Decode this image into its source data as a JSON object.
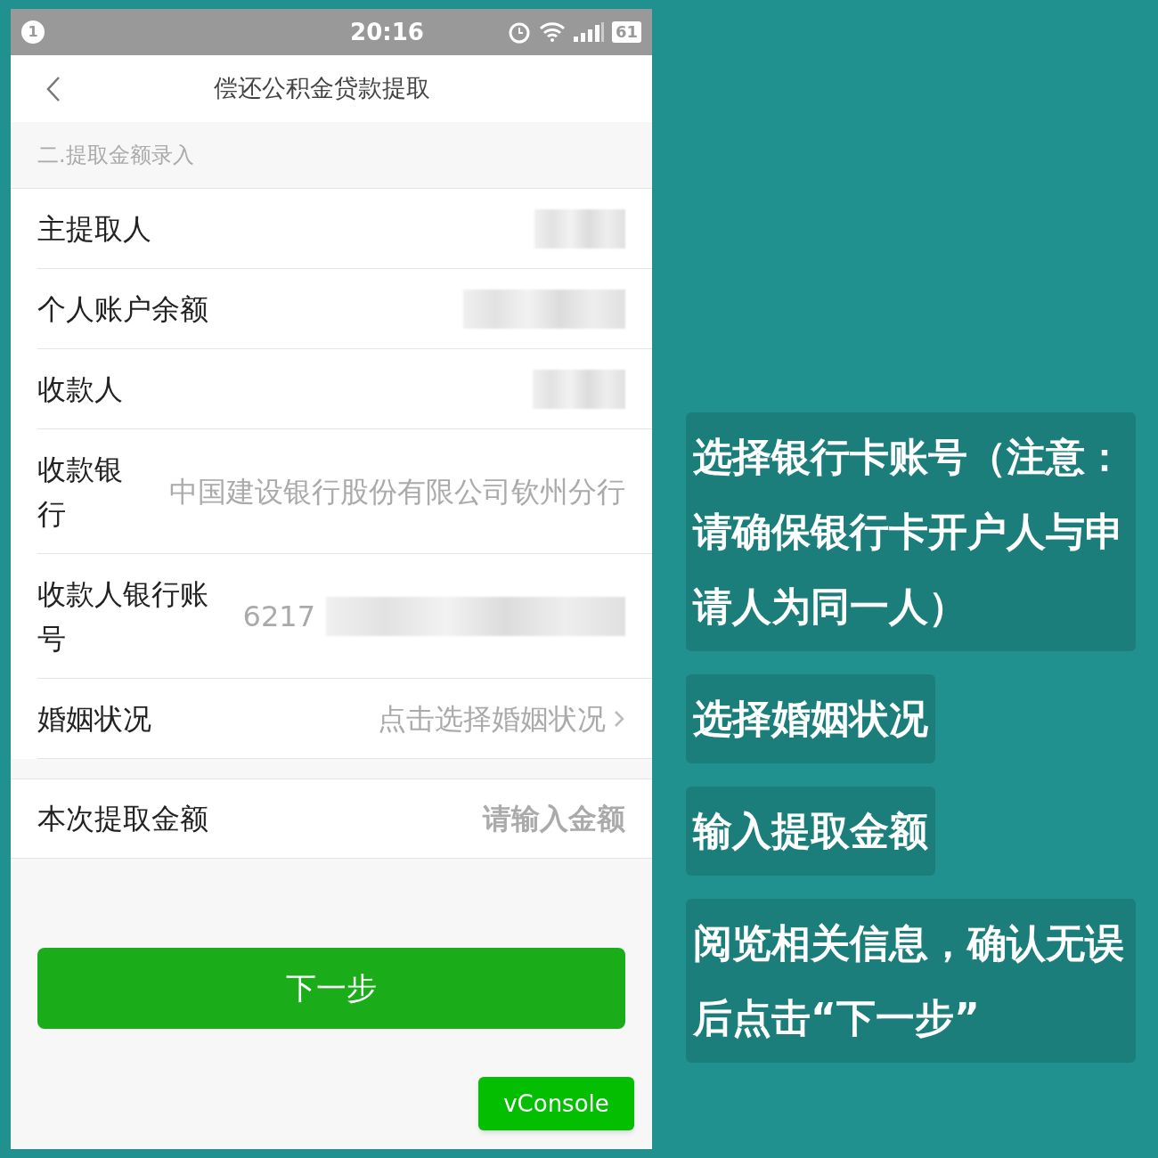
{
  "status_bar": {
    "notification_count": "1",
    "time": "20:16",
    "battery": "61"
  },
  "nav": {
    "title": "偿还公积金贷款提取"
  },
  "section_header": "二.提取金额录入",
  "rows": [
    {
      "kind": "redacted",
      "label": "主提取人"
    },
    {
      "kind": "redacted",
      "label": "个人账户余额"
    },
    {
      "kind": "redacted",
      "label": "收款人"
    },
    {
      "kind": "text",
      "label": "收款银行",
      "value": "中国建设银行股份有限公司钦州分行"
    },
    {
      "kind": "partial",
      "label": "收款人银行账号",
      "value": "6217"
    },
    {
      "kind": "select",
      "label": "婚姻状况",
      "placeholder": "点击选择婚姻状况"
    }
  ],
  "amount_row": {
    "label": "本次提取金额",
    "placeholder": "请输入金额"
  },
  "next_button": "下一步",
  "vconsole_button": "vConsole",
  "annotations": [
    "选择银行卡账号（注意：请确保银行卡开户人与申请人为同一人）",
    "选择婚姻状况",
    "输入提取金额",
    "阅览相关信息，确认无误后点击“下一步”"
  ]
}
